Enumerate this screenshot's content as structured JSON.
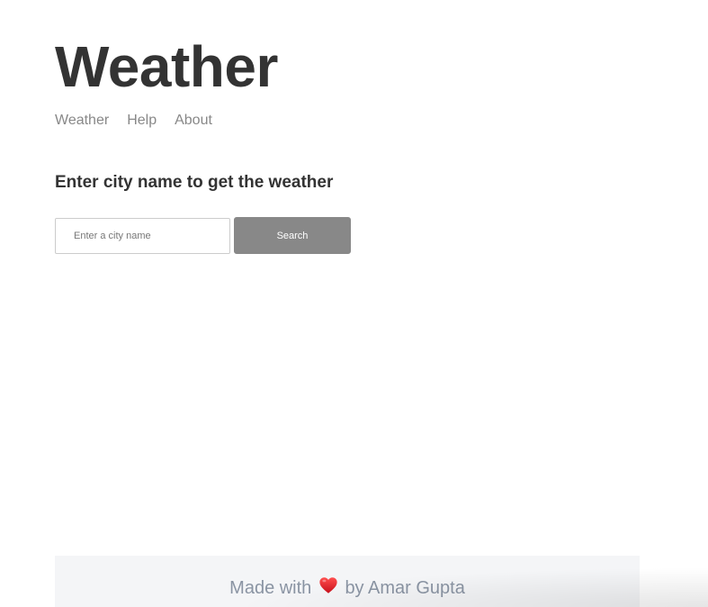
{
  "header": {
    "title": "Weather",
    "nav": [
      {
        "label": "Weather"
      },
      {
        "label": "Help"
      },
      {
        "label": "About"
      }
    ]
  },
  "main": {
    "prompt": "Enter city name to get the weather",
    "search": {
      "placeholder": "Enter a city name",
      "value": "",
      "button_label": "Search"
    }
  },
  "footer": {
    "prefix": "Made with",
    "icon": "heart-icon",
    "suffix": "by Amar Gupta"
  },
  "colors": {
    "text": "#333333",
    "nav_link": "#888888",
    "button_bg": "#888888",
    "footer_bg": "#f4f5f7",
    "footer_text": "#8a94a3",
    "heart": "#e0242e"
  }
}
